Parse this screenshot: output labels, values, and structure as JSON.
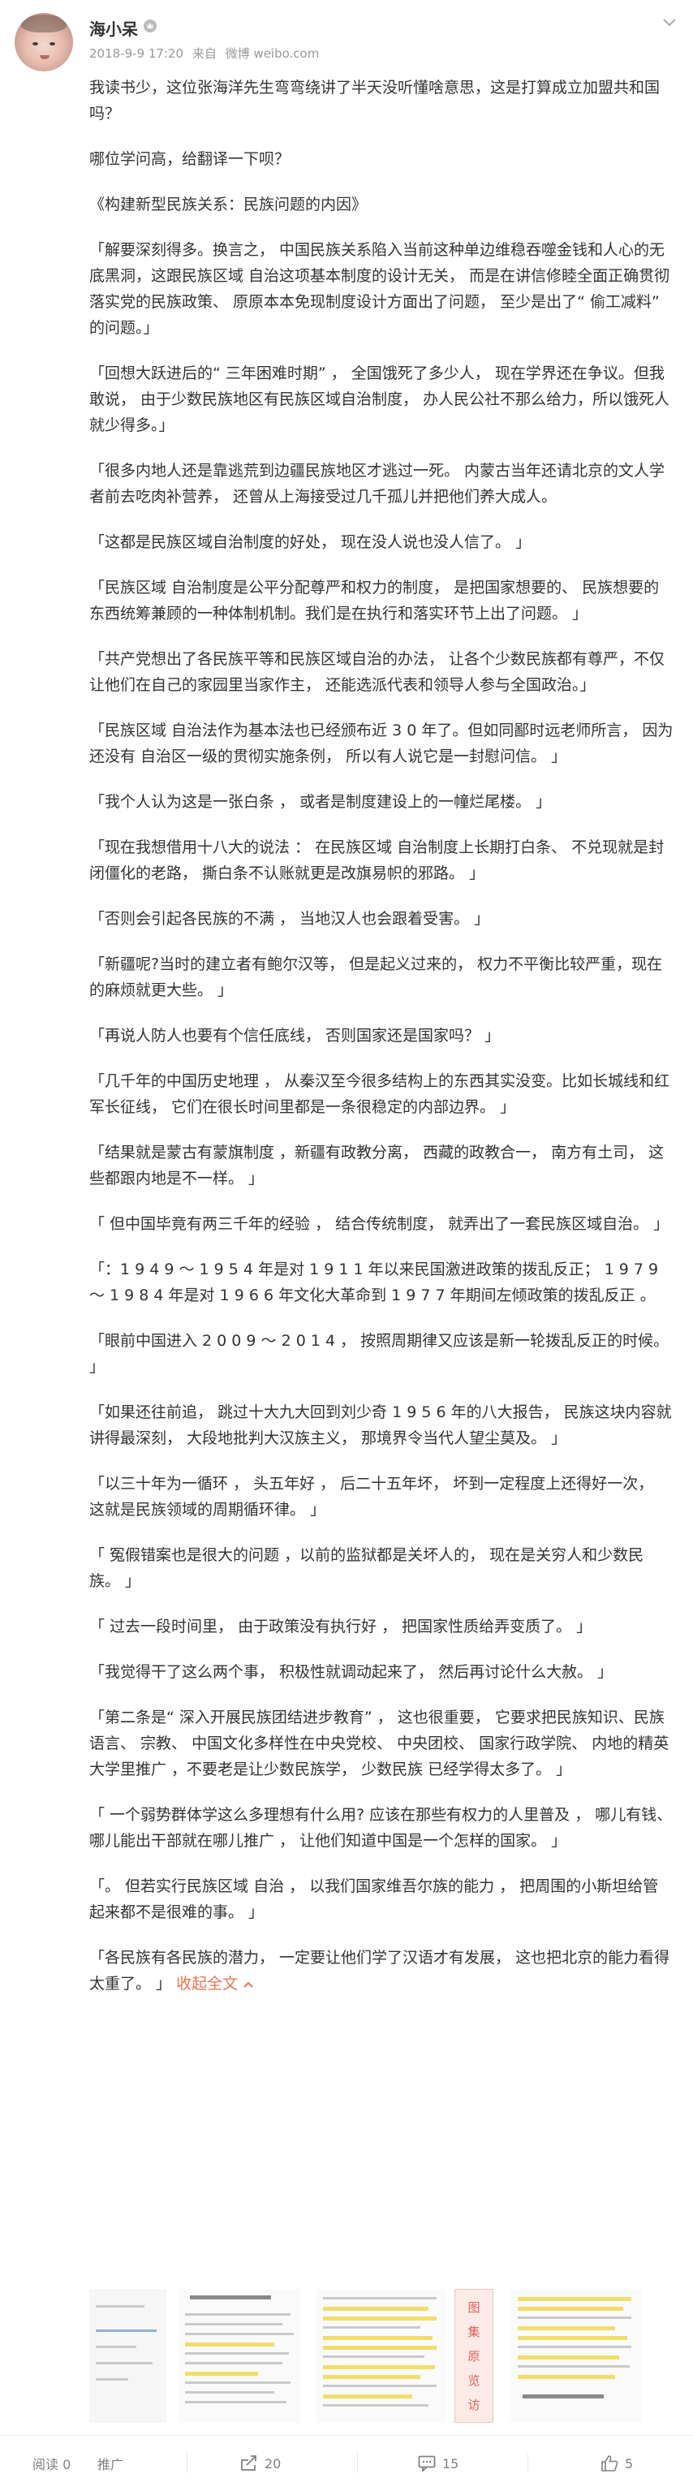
{
  "post": {
    "username": "海小呆",
    "badge_icon": "membership-badge-icon",
    "timestamp": "2018-9-9 17:20",
    "source_prefix": "来自",
    "source": "微博 weibo.com",
    "more_icon": "chevron-down-icon"
  },
  "content": {
    "paragraphs": [
      "我读书少，这位张海洋先生弯弯绕讲了半天没听懂啥意思，这是打算成立加盟共和国吗？",
      "哪位学问高，给翻译一下呗？",
      "《构建新型民族关系：民族问题的内因》",
      "「解要深刻得多。换言之， 中国民族关系陷入当前这种单边维稳吞噬金钱和人心的无底黑洞，这跟民族区域 自治这项基本制度的设计无关， 而是在讲信修睦全面正确贯彻落实党的民族政策、 原原本本免现制度设计方面出了问题， 至少是出了“ 偷工减料” 的问题。」",
      "「回想大跃进后的“ 三年困难时期” ， 全国饿死了多少人， 现在学界还在争议。但我敢说， 由于少数民族地区有民族区域自治制度， 办人民公社不那么给力，所以饿死人就少得多。」",
      "「很多内地人还是靠逃荒到边疆民族地区才逃过一死。 内蒙古当年还请北京的文人学者前去吃肉补营养， 还曾从上海接受过几千孤儿并把他们养大成人。",
      "「这都是民族区域自治制度的好处， 现在没人说也没人信了。 」",
      "「民族区域 自治制度是公平分配尊严和权力的制度， 是把国家想要的、 民族想要的\n东西统筹兼顾的一种体制机制。我们是在执行和落实环节上出了问题。 」",
      "「共产党想出了各民族平等和民族区域自治的办法， 让各个少数民族都有尊严，不仅让他们在自己的家园里当家作主， 还能选派代表和领导人参与全国政治。」",
      "「民族区域 自治法作为基本法也已经颁布近 3 0 年了。但如同鄙时远老师所言， 因为还没有 自治区一级的贯彻实施条例， 所以有人说它是一封慰问信。 」",
      "「我个人认为这是一张白条 ， 或者是制度建设上的一幢烂尾楼。 」",
      "「现在我想借用十八大的说法 ： 在民族区域 自治制度上长期打白条、 不兑现就是封闭僵化的老路， 撕白条不认账就更是改旗易帜的邪路。 」",
      "「否则会引起各民族的不满 ， 当地汉人也会跟着受害。 」",
      "「新疆呢?当时的建立者有鲍尔汉等， 但是起义过来的， 权力不平衡比较严重，现在的麻烦就更大些。 」",
      "「再说人防人也要有个信任底线， 否则国家还是国家吗？ 」",
      "「几千年的中国历史地理 ， 从秦汉至今很多结构上的东西其实没变。比如长城线和红军长征线， 它们在很长时间里都是一条很稳定的内部边界。 」",
      "「结果就是蒙古有蒙旗制度 ，新疆有政教分离， 西藏的政教合一， 南方有土司， 这些都跟内地是不一样。 」",
      "「 但中国毕竟有两三千年的经验 ， 结合传统制度， 就弄出了一套民族区域自治。 」",
      "「：1 9 4 9 ～ 1 9 5 4 年是对 1 9 1 1 年以来民国激进政策的拨乱反正； 1 9 7 9 ～ 1 9 8 4 年是对 1 9 6 6 年文化大革命到 1 9 7 7 年期间左倾政策的拨乱反正 。",
      "「眼前中国进入 2 0 0 9 ～ 2 0 1 4 ， 按照周期律又应该是新一轮拨乱反正的时候。 」",
      "「如果还往前追， 跳过十大九大回到刘少奇 1 9 5 6 年的八大报告， 民族这块内容就讲得最深刻， 大段地批判大汉族主义， 那境界令当代人望尘莫及。 」",
      "「以三十年为一循环 ， 头五年好 ， 后二十五年坏， 坏到一定程度上还得好一次， 这就是民族领域的周期循环律。 」",
      "「 冤假错案也是很大的问题 ，以前的监狱都是关坏人的， 现在是关穷人和少数民族。 」",
      "「 过去一段时间里， 由于政策没有执行好 ， 把国家性质给弄变质了。 」",
      "「我觉得干了这么两个事， 积极性就调动起来了， 然后再讨论什么大赦。 」",
      "「第二条是“ 深入开展民族团结进步教育” ， 这也很重要， 它要求把民族知识、民族语言、 宗教、 中国文化多样性在中央党校、 中央团校、 国家行政学院、 内地的精英大学里推广 ，不要老是让少数民族学， 少数民族 已经学得太多了。 」",
      "「 一个弱势群体学这么多理想有什么用? 应该在那些有权力的人里普及 ， 哪儿有钱、 哪儿能出干部就在哪儿推广 ， 让他们知道中国是一个怎样的国家。 」",
      "「。 但若实行民族区域 自治 ， 以我们国家维吾尔族的能力 ， 把周围的小斯坦给管起来都不是很难的事。 」"
    ],
    "last_paragraph": "「各民族有各民族的潜力， 一定要让他们学了汉语才有发展， 这也把北京的能力看得太重了。 」",
    "collapse_label": "收起全文",
    "collapse_icon": "chevron-up-icon"
  },
  "images": {
    "sidebar_text": [
      "图",
      "集",
      "原",
      "览",
      "访"
    ]
  },
  "footer": {
    "read_label": "阅读 0",
    "promote_label": "推广",
    "repost_count": "20",
    "comment_count": "15",
    "like_count": "5",
    "repost_icon": "share-icon",
    "comment_icon": "comment-icon",
    "like_icon": "thumbs-up-icon"
  }
}
